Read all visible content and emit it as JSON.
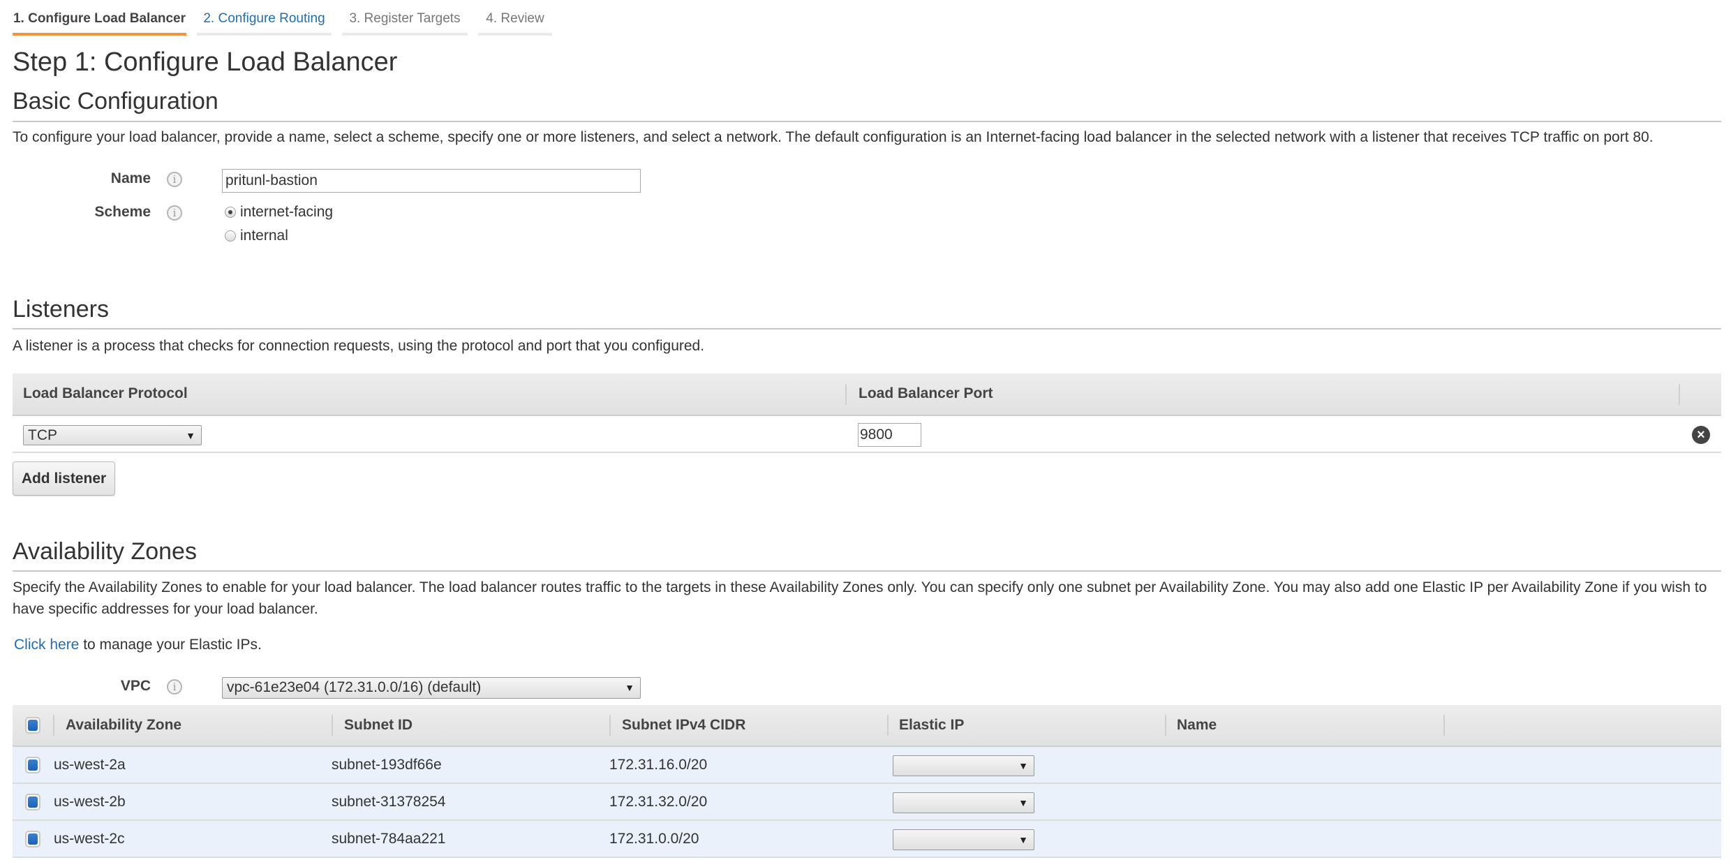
{
  "tabs": [
    {
      "label": "1. Configure Load Balancer",
      "state": "active"
    },
    {
      "label": "2. Configure Routing",
      "state": "link"
    },
    {
      "label": "3. Register Targets",
      "state": "disabled"
    },
    {
      "label": "4. Review",
      "state": "disabled"
    }
  ],
  "page_title": "Step 1: Configure Load Balancer",
  "basic": {
    "title": "Basic Configuration",
    "description": "To configure your load balancer, provide a name, select a scheme, specify one or more listeners, and select a network. The default configuration is an Internet-facing load balancer in the selected network with a listener that receives TCP traffic on port 80.",
    "name_label": "Name",
    "name_value": "pritunl-bastion",
    "scheme_label": "Scheme",
    "scheme_options": [
      {
        "label": "internet-facing",
        "selected": true
      },
      {
        "label": "internal",
        "selected": false
      }
    ],
    "info_icon": "i"
  },
  "listeners": {
    "title": "Listeners",
    "description": "A listener is a process that checks for connection requests, using the protocol and port that you configured.",
    "columns": [
      "Load Balancer Protocol",
      "Load Balancer Port"
    ],
    "rows": [
      {
        "protocol": "TCP",
        "port": "9800"
      }
    ],
    "add_button": "Add listener",
    "remove_icon": "×",
    "caret": "▼"
  },
  "availability_zones": {
    "title": "Availability Zones",
    "description": "Specify the Availability Zones to enable for your load balancer. The load balancer routes traffic to the targets in these Availability Zones only. You can specify only one subnet per Availability Zone. You may also add one Elastic IP per Availability Zone if you wish to have specific addresses for your load balancer.",
    "eip_link": "Click here",
    "eip_text": " to manage your Elastic IPs.",
    "vpc_label": "VPC",
    "vpc_value": "vpc-61e23e04 (172.31.0.0/16) (default)",
    "columns": [
      "Availability Zone",
      "Subnet ID",
      "Subnet IPv4 CIDR",
      "Elastic IP",
      "Name"
    ],
    "rows": [
      {
        "zone": "us-west-2a",
        "subnet": "subnet-193df66e",
        "cidr": "172.31.16.0/20",
        "elastic_ip": "",
        "name": "",
        "checked": true
      },
      {
        "zone": "us-west-2b",
        "subnet": "subnet-31378254",
        "cidr": "172.31.32.0/20",
        "elastic_ip": "",
        "name": "",
        "checked": true
      },
      {
        "zone": "us-west-2c",
        "subnet": "subnet-784aa221",
        "cidr": "172.31.0.0/20",
        "elastic_ip": "",
        "name": "",
        "checked": true
      }
    ]
  },
  "colors": {
    "active_tab_underline": "#f0953b",
    "link": "#1f6eb5",
    "checkbox_fill": "#2a6fc3",
    "selected_row_bg": "#eaf1fb"
  }
}
